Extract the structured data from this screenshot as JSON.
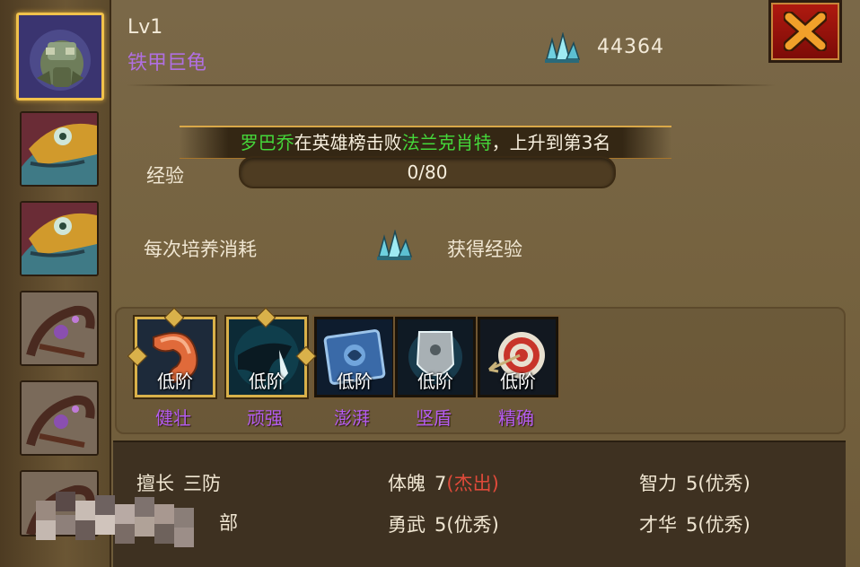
{
  "hero": {
    "level": "Lv1",
    "name": "铁甲巨龟"
  },
  "currency": {
    "icon": "crystal-icon",
    "amount": "44364"
  },
  "close": {
    "icon": "close-x-icon"
  },
  "banner": {
    "player": "罗巴乔",
    "mid": "在英雄榜击败",
    "target": "法兰克肖特",
    "tail": "，上升到第3名"
  },
  "experience": {
    "label": "经验",
    "text": "0/80",
    "progress": 0
  },
  "cultivate": {
    "cost_label": "每次培养消耗",
    "gain_label": "获得经验",
    "icon": "crystal-icon"
  },
  "skills": [
    {
      "name": "健壮",
      "level": "低阶",
      "icon": "muscle-arm-icon",
      "framed": true
    },
    {
      "name": "顽强",
      "level": "低阶",
      "icon": "beast-claw-icon",
      "framed": true
    },
    {
      "name": "澎湃",
      "level": "低阶",
      "icon": "spellbook-icon",
      "framed": false
    },
    {
      "name": "坚盾",
      "level": "低阶",
      "icon": "shield-icon",
      "framed": false
    },
    {
      "name": "精确",
      "level": "低阶",
      "icon": "target-arrow-icon",
      "framed": false
    }
  ],
  "stats": {
    "specialty": {
      "label": "擅长",
      "value": "三防"
    },
    "line2_partial": "部",
    "physique": {
      "label": "体魄",
      "value": "7",
      "grade": "(杰出)"
    },
    "intellect": {
      "label": "智力",
      "value": "5",
      "grade": "(优秀)"
    },
    "valor": {
      "label": "勇武",
      "value": "5",
      "grade": "(优秀)"
    },
    "talent": {
      "label": "才华",
      "value": "5",
      "grade": "(优秀)"
    }
  },
  "colors": {
    "name_purple": "#b06fe0",
    "skill_purple": "#b45cf0",
    "banner_green": "#45d83a",
    "grade_red": "#e04a3a",
    "frame_gold": "#d9b14a"
  }
}
